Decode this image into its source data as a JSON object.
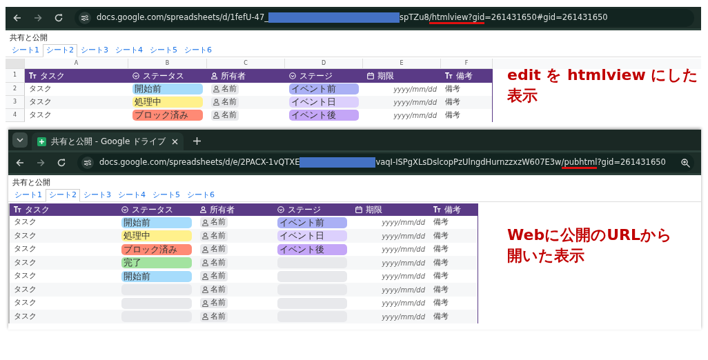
{
  "windows": [
    {
      "kind": "edit",
      "url_start": "docs.google.com/spreadsheets/d/1fefU-47_",
      "url_end": [
        {
          "text": "spTZu8"
        },
        {
          "text": "/htmlview?gid",
          "underlined": true
        },
        {
          "text": "=261431650#gid=261431650"
        }
      ],
      "doc_title": "共有と公開",
      "sheet_tabs": [
        {
          "label": "シート1",
          "selected": false
        },
        {
          "label": "シート2",
          "selected": true
        },
        {
          "label": "シート3",
          "selected": false
        },
        {
          "label": "シート4",
          "selected": false
        },
        {
          "label": "シート5",
          "selected": false
        },
        {
          "label": "シート6",
          "selected": false
        }
      ],
      "column_letters": [
        "A",
        "B",
        "C",
        "D",
        "E",
        "F"
      ],
      "row_numbers": [
        "1",
        "2",
        "3",
        "4"
      ],
      "columns": [
        {
          "label": "タスク"
        },
        {
          "label": "ステータス"
        },
        {
          "label": "所有者"
        },
        {
          "label": "ステージ"
        },
        {
          "label": "期限"
        },
        {
          "label": "備考"
        }
      ],
      "rows": [
        {
          "task": "タスク",
          "status": {
            "text": "開始前",
            "color": "#a6dcfc"
          },
          "owner": "名前",
          "stage": {
            "text": "イベント前",
            "color": "#aab0f5"
          },
          "due": "yyyy/mm/dd",
          "note": "備考"
        },
        {
          "task": "タスク",
          "status": {
            "text": "処理中",
            "color": "#fff18c"
          },
          "owner": "名前",
          "stage": {
            "text": "イベント日",
            "color": "#dcd0fd"
          },
          "due": "yyyy/mm/dd",
          "note": "備考"
        },
        {
          "task": "タスク",
          "status": {
            "text": "ブロック済み",
            "color": "#ff8a75"
          },
          "owner": "名前",
          "stage": {
            "text": "イベント後",
            "color": "#c4a6f7"
          },
          "due": "yyyy/mm/dd",
          "note": "備考"
        }
      ]
    },
    {
      "kind": "published",
      "tab_title": "共有と公開 - Google ドライブ",
      "url_start": "docs.google.com/spreadsheets/d/e/2PACX-1vQTXE",
      "url_end": [
        {
          "text": "vaqI-ISPgXLsDslcopPzUlngdHurnzzxzW607E3w"
        },
        {
          "text": "/pubhtml",
          "underlined": true
        },
        {
          "text": "?gid=261431650"
        }
      ],
      "doc_title": "共有と公開",
      "sheet_tabs": [
        {
          "label": "シート1",
          "selected": false
        },
        {
          "label": "シート2",
          "selected": true
        },
        {
          "label": "シート3",
          "selected": false
        },
        {
          "label": "シート4",
          "selected": false
        },
        {
          "label": "シート5",
          "selected": false
        },
        {
          "label": "シート6",
          "selected": false
        }
      ],
      "columns": [
        {
          "label": "タスク"
        },
        {
          "label": "ステータス"
        },
        {
          "label": "所有者"
        },
        {
          "label": "ステージ"
        },
        {
          "label": "期限"
        },
        {
          "label": "備考"
        }
      ],
      "rows": [
        {
          "task": "タスク",
          "status": {
            "text": "開始前",
            "color": "#a6dcfc"
          },
          "owner": "名前",
          "stage": {
            "text": "イベント前",
            "color": "#aab0f5"
          },
          "due": "yyyy/mm/dd",
          "note": "備考"
        },
        {
          "task": "タスク",
          "status": {
            "text": "処理中",
            "color": "#fff18c"
          },
          "owner": "名前",
          "stage": {
            "text": "イベント日",
            "color": "#dcd0fd"
          },
          "due": "yyyy/mm/dd",
          "note": "備考"
        },
        {
          "task": "タスク",
          "status": {
            "text": "ブロック済み",
            "color": "#ff8a75"
          },
          "owner": "名前",
          "stage": {
            "text": "イベント後",
            "color": "#c4a6f7"
          },
          "due": "yyyy/mm/dd",
          "note": "備考"
        },
        {
          "task": "タスク",
          "status": {
            "text": "完了",
            "color": "#a3e3a0"
          },
          "owner": "名前",
          "stage": {
            "color": "#e8e9ec"
          },
          "due": "yyyy/mm/dd",
          "note": "備考"
        },
        {
          "task": "タスク",
          "status": {
            "text": "開始前",
            "color": "#a6dcfc"
          },
          "owner": "名前",
          "stage": {
            "color": "#e8e9ec"
          },
          "due": "yyyy/mm/dd",
          "note": "備考"
        },
        {
          "task": "タスク",
          "status": {
            "color": "#e8e9ec"
          },
          "owner": "名前",
          "stage": {
            "color": "#e8e9ec"
          },
          "due": "yyyy/mm/dd",
          "note": "備考"
        },
        {
          "task": "タスク",
          "status": {
            "color": "#e8e9ec"
          },
          "owner": "名前",
          "stage": {
            "color": "#e8e9ec"
          },
          "due": "yyyy/mm/dd",
          "note": "備考"
        },
        {
          "task": "タスク",
          "status": {
            "color": "#e8e9ec"
          },
          "owner": "名前",
          "stage": {
            "color": "#e8e9ec"
          },
          "due": "yyyy/mm/dd",
          "note": "備考"
        }
      ]
    }
  ],
  "annotations": [
    {
      "lines": [
        "edit を htmlview にした",
        "表示"
      ]
    },
    {
      "lines": [
        "Webに公開のURLから",
        "開いた表示"
      ]
    }
  ]
}
